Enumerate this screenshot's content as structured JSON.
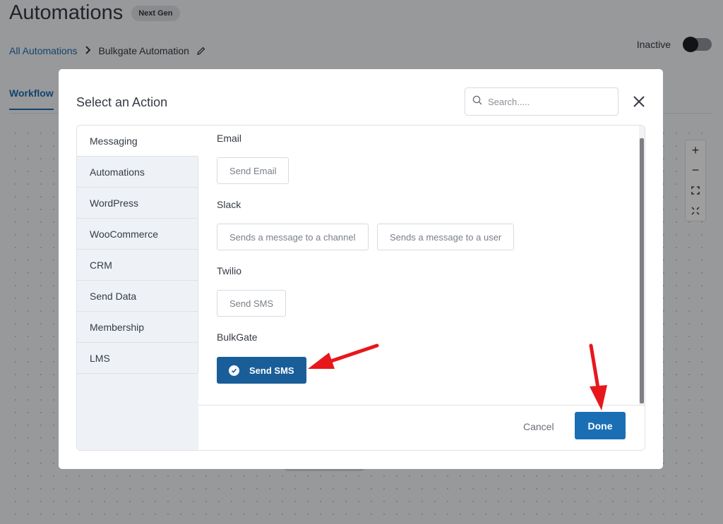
{
  "header": {
    "title": "Automations",
    "badge": "Next Gen"
  },
  "breadcrumb": {
    "root": "All Automations",
    "current": "Bulkgate Automation"
  },
  "status": {
    "label": "Inactive",
    "enabled": false
  },
  "tabs": {
    "workflow": "Workflow"
  },
  "zoom_controls": {
    "zoom_in": "+",
    "zoom_out": "−"
  },
  "modal": {
    "title": "Select an Action",
    "search_placeholder": "Search.....",
    "categories": [
      {
        "label": "Messaging",
        "active": true
      },
      {
        "label": "Automations",
        "active": false
      },
      {
        "label": "WordPress",
        "active": false
      },
      {
        "label": "WooCommerce",
        "active": false
      },
      {
        "label": "CRM",
        "active": false
      },
      {
        "label": "Send Data",
        "active": false
      },
      {
        "label": "Membership",
        "active": false
      },
      {
        "label": "LMS",
        "active": false
      }
    ],
    "groups": [
      {
        "title": "Email",
        "actions": [
          "Send Email"
        ]
      },
      {
        "title": "Slack",
        "actions": [
          "Sends a message to a channel",
          "Sends a message to a user"
        ]
      },
      {
        "title": "Twilio",
        "actions": [
          "Send SMS"
        ]
      },
      {
        "title": "BulkGate",
        "actions": [
          "Send SMS"
        ],
        "selected": 0
      }
    ],
    "cancel_label": "Cancel",
    "done_label": "Done"
  },
  "colors": {
    "accent": "#1a6fb4",
    "selected_action": "#1a5e99",
    "annotation_arrow": "#e8171c"
  }
}
